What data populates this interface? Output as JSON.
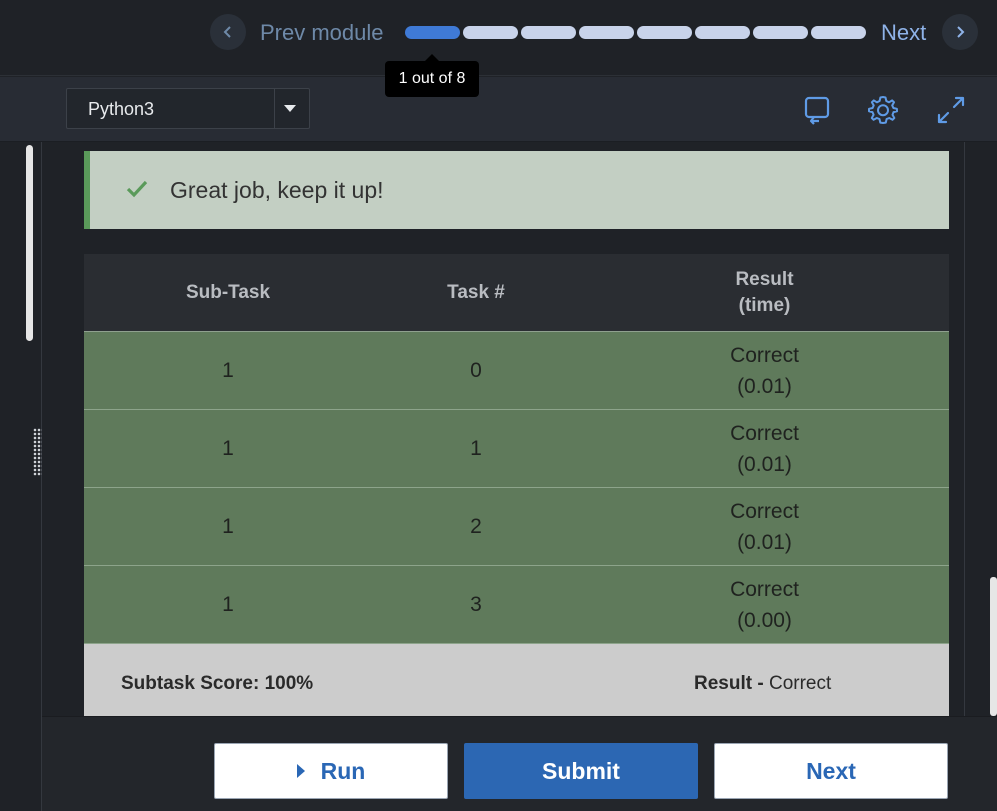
{
  "nav": {
    "prev_label": "Prev module",
    "next_label": "Next",
    "progress_total": 8,
    "progress_current": 1,
    "tooltip": "1 out of 8"
  },
  "toolbar": {
    "language": "Python3",
    "icons": [
      "reset-code-icon",
      "gear-icon",
      "fullscreen-icon"
    ]
  },
  "alert": {
    "message": "Great job, keep it up!"
  },
  "results": {
    "headers": [
      "Sub-Task",
      "Task #",
      "Result\n(time)"
    ],
    "rows": [
      {
        "subtask": "1",
        "task": "0",
        "result": "Correct",
        "time": "(0.01)"
      },
      {
        "subtask": "1",
        "task": "1",
        "result": "Correct",
        "time": "(0.01)"
      },
      {
        "subtask": "1",
        "task": "2",
        "result": "Correct",
        "time": "(0.01)"
      },
      {
        "subtask": "1",
        "task": "3",
        "result": "Correct",
        "time": "(0.00)"
      }
    ],
    "score_label": "Subtask Score: 100%",
    "result_label": "Result -",
    "result_value": "Correct"
  },
  "actions": {
    "run": "Run",
    "submit": "Submit",
    "next": "Next"
  },
  "colors": {
    "accent": "#2c67b3",
    "progress_active": "#3f7ad6",
    "success_bar": "#5a9a5a",
    "row_bg": "#5f7a5b"
  }
}
